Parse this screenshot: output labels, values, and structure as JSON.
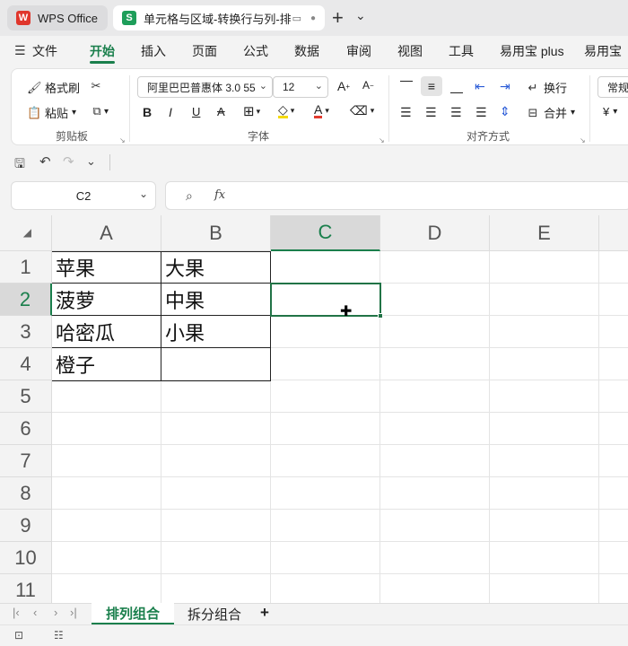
{
  "window": {
    "tabs": [
      {
        "label": "WPS Office",
        "icon": "wps-logo-icon"
      },
      {
        "label": "单元格与区域-转换行与列-排"
      }
    ],
    "new_tab": "+",
    "tab_dropdown": "⌄"
  },
  "menu": {
    "file": "文件",
    "items": [
      "开始",
      "插入",
      "页面",
      "公式",
      "数据",
      "审阅",
      "视图",
      "工具",
      "易用宝 plus",
      "易用宝"
    ]
  },
  "ribbon": {
    "format_painter": "格式刷",
    "paste": "粘贴",
    "clipboard_group": "剪贴板",
    "font_name": "阿里巴巴普惠体 3.0 55",
    "font_size": "12",
    "font_group": "字体",
    "wrap": "换行",
    "merge": "合并",
    "align_group": "对齐方式",
    "number_format": "常规",
    "currency_symbol": "¥"
  },
  "formula_bar": {
    "name_box": "C2",
    "fx": "fx",
    "value": ""
  },
  "grid": {
    "columns": [
      "A",
      "B",
      "C",
      "D",
      "E"
    ],
    "rows": [
      "1",
      "2",
      "3",
      "4",
      "5",
      "6",
      "7",
      "8",
      "9",
      "10",
      "11"
    ],
    "selected_cell": "C2",
    "cells": {
      "A1": "苹果",
      "B1": "大果",
      "A2": "菠萝",
      "B2": "中果",
      "A3": "哈密瓜",
      "B3": "小果",
      "A4": "橙子",
      "B4": ""
    }
  },
  "sheet_tabs": {
    "tabs": [
      "排列组合",
      "拆分组合"
    ],
    "active": "排列组合",
    "add": "+"
  },
  "colors": {
    "accent": "#1a7f4c",
    "selection": "#217346"
  }
}
